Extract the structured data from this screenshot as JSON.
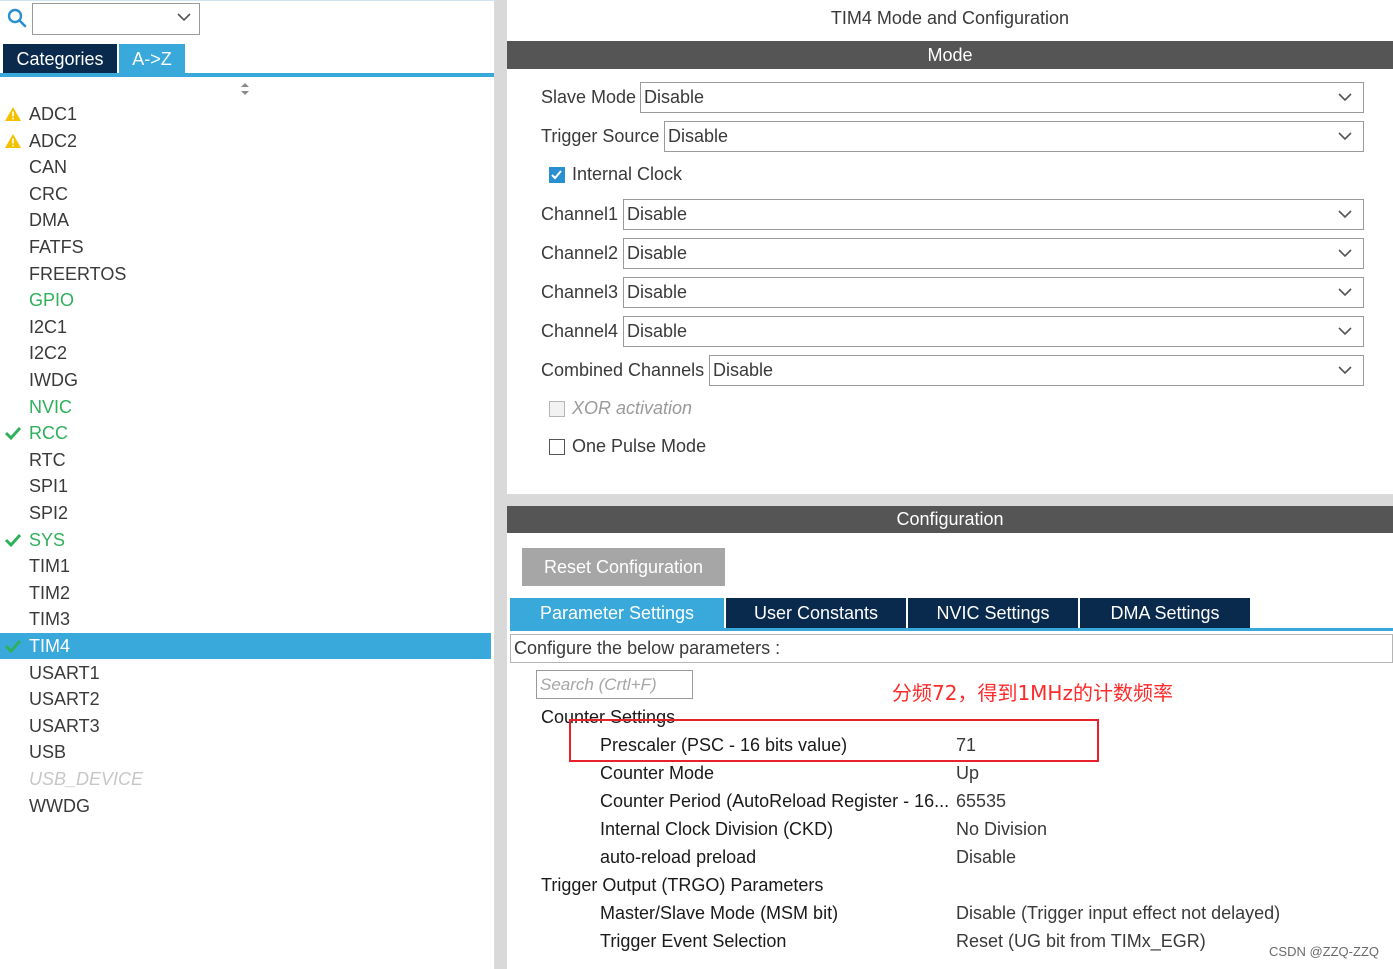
{
  "left_panel": {
    "search": {
      "value": ""
    },
    "tabs": {
      "categories": "Categories",
      "a_to_z": "A->Z"
    },
    "items": [
      {
        "label": "ADC1",
        "status": "warning"
      },
      {
        "label": "ADC2",
        "status": "warning"
      },
      {
        "label": "CAN",
        "status": "normal"
      },
      {
        "label": "CRC",
        "status": "normal"
      },
      {
        "label": "DMA",
        "status": "normal"
      },
      {
        "label": "FATFS",
        "status": "normal"
      },
      {
        "label": "FREERTOS",
        "status": "normal"
      },
      {
        "label": "GPIO",
        "status": "green"
      },
      {
        "label": "I2C1",
        "status": "normal"
      },
      {
        "label": "I2C2",
        "status": "normal"
      },
      {
        "label": "IWDG",
        "status": "normal"
      },
      {
        "label": "NVIC",
        "status": "green"
      },
      {
        "label": "RCC",
        "status": "checked"
      },
      {
        "label": "RTC",
        "status": "normal"
      },
      {
        "label": "SPI1",
        "status": "normal"
      },
      {
        "label": "SPI2",
        "status": "normal"
      },
      {
        "label": "SYS",
        "status": "checked"
      },
      {
        "label": "TIM1",
        "status": "normal"
      },
      {
        "label": "TIM2",
        "status": "normal"
      },
      {
        "label": "TIM3",
        "status": "normal"
      },
      {
        "label": "TIM4",
        "status": "selected"
      },
      {
        "label": "USART1",
        "status": "normal"
      },
      {
        "label": "USART2",
        "status": "normal"
      },
      {
        "label": "USART3",
        "status": "normal"
      },
      {
        "label": "USB",
        "status": "normal"
      },
      {
        "label": "USB_DEVICE",
        "status": "disabled"
      },
      {
        "label": "WWDG",
        "status": "normal"
      }
    ]
  },
  "right_panel": {
    "title": "TIM4 Mode and Configuration",
    "mode_header": "Mode",
    "mode": {
      "slave_mode": {
        "label": "Slave Mode",
        "value": "Disable"
      },
      "trigger_source": {
        "label": "Trigger Source",
        "value": "Disable"
      },
      "internal_clock": {
        "label": "Internal Clock",
        "checked": true
      },
      "channel1": {
        "label": "Channel1",
        "value": "Disable"
      },
      "channel2": {
        "label": "Channel2",
        "value": "Disable"
      },
      "channel3": {
        "label": "Channel3",
        "value": "Disable"
      },
      "channel4": {
        "label": "Channel4",
        "value": "Disable"
      },
      "combined_channels": {
        "label": "Combined Channels",
        "value": "Disable"
      },
      "xor_activation": {
        "label": "XOR activation",
        "checked": false,
        "enabled": false
      },
      "one_pulse_mode": {
        "label": "One Pulse Mode",
        "checked": false
      }
    },
    "config_header": "Configuration",
    "reset_button": "Reset Configuration",
    "tabs": {
      "parameter_settings": "Parameter Settings",
      "user_constants": "User Constants",
      "nvic_settings": "NVIC Settings",
      "dma_settings": "DMA Settings"
    },
    "configure_hint": "Configure the below parameters :",
    "search_placeholder": "Search (Crtl+F)",
    "annotation": "分频72，得到1MHz的计数频率",
    "groups": {
      "counter_settings": {
        "title": "Counter Settings",
        "params": [
          {
            "name": "Prescaler (PSC - 16 bits value)",
            "value": "71"
          },
          {
            "name": "Counter Mode",
            "value": "Up"
          },
          {
            "name": "Counter Period (AutoReload Register - 16...",
            "value": "65535"
          },
          {
            "name": "Internal Clock Division (CKD)",
            "value": "No Division"
          },
          {
            "name": "auto-reload preload",
            "value": "Disable"
          }
        ]
      },
      "trigger_output": {
        "title": "Trigger Output (TRGO) Parameters",
        "params": [
          {
            "name": "Master/Slave Mode (MSM bit)",
            "value": "Disable (Trigger input effect not delayed)"
          },
          {
            "name": "Trigger Event Selection",
            "value": "Reset (UG bit from TIMx_EGR)"
          }
        ]
      }
    },
    "watermark": "CSDN @ZZQ-ZZQ"
  },
  "colors": {
    "accent": "#39a9dc",
    "dark_tab": "#0a2a4d",
    "band": "#555555",
    "green": "#2fb05a",
    "warning": "#f2c200",
    "annotation_red": "#ff2a2a"
  }
}
